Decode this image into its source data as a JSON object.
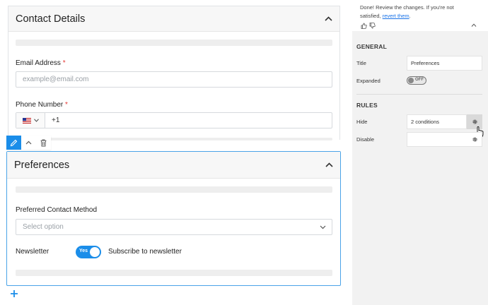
{
  "form": {
    "contact": {
      "title": "Contact Details",
      "email_label": "Email Address",
      "email_placeholder": "example@email.com",
      "phone_label": "Phone Number",
      "phone_prefix": "+1",
      "required_mark": "*"
    },
    "preferences": {
      "title": "Preferences",
      "method_label": "Preferred Contact Method",
      "method_placeholder": "Select option",
      "newsletter_label": "Newsletter",
      "toggle_text": "Yes",
      "subscribe_text": "Subscribe to newsletter",
      "newsletter_on": true
    }
  },
  "panel": {
    "notice": {
      "text": "Done! Review the changes. If you're not satisfied,",
      "link": "revert them",
      "after_link": "."
    },
    "general": {
      "title": "GENERAL",
      "title_label": "Title",
      "title_value": "Preferences",
      "expanded_label": "Expanded",
      "expanded_state": "OFF"
    },
    "rules": {
      "title": "RULES",
      "hide_label": "Hide",
      "hide_value": "2 conditions",
      "disable_label": "Disable",
      "disable_value": ""
    }
  },
  "colors": {
    "accent": "#1a8de9",
    "required": "#e53935",
    "selected_border": "#4aa3e8"
  },
  "icons": [
    "chevron-up-icon",
    "pencil-icon",
    "trash-icon",
    "plus-icon",
    "us-flag-icon",
    "gear-icon",
    "thumbs-up-icon",
    "thumbs-down-icon",
    "cursor-hand-icon"
  ]
}
